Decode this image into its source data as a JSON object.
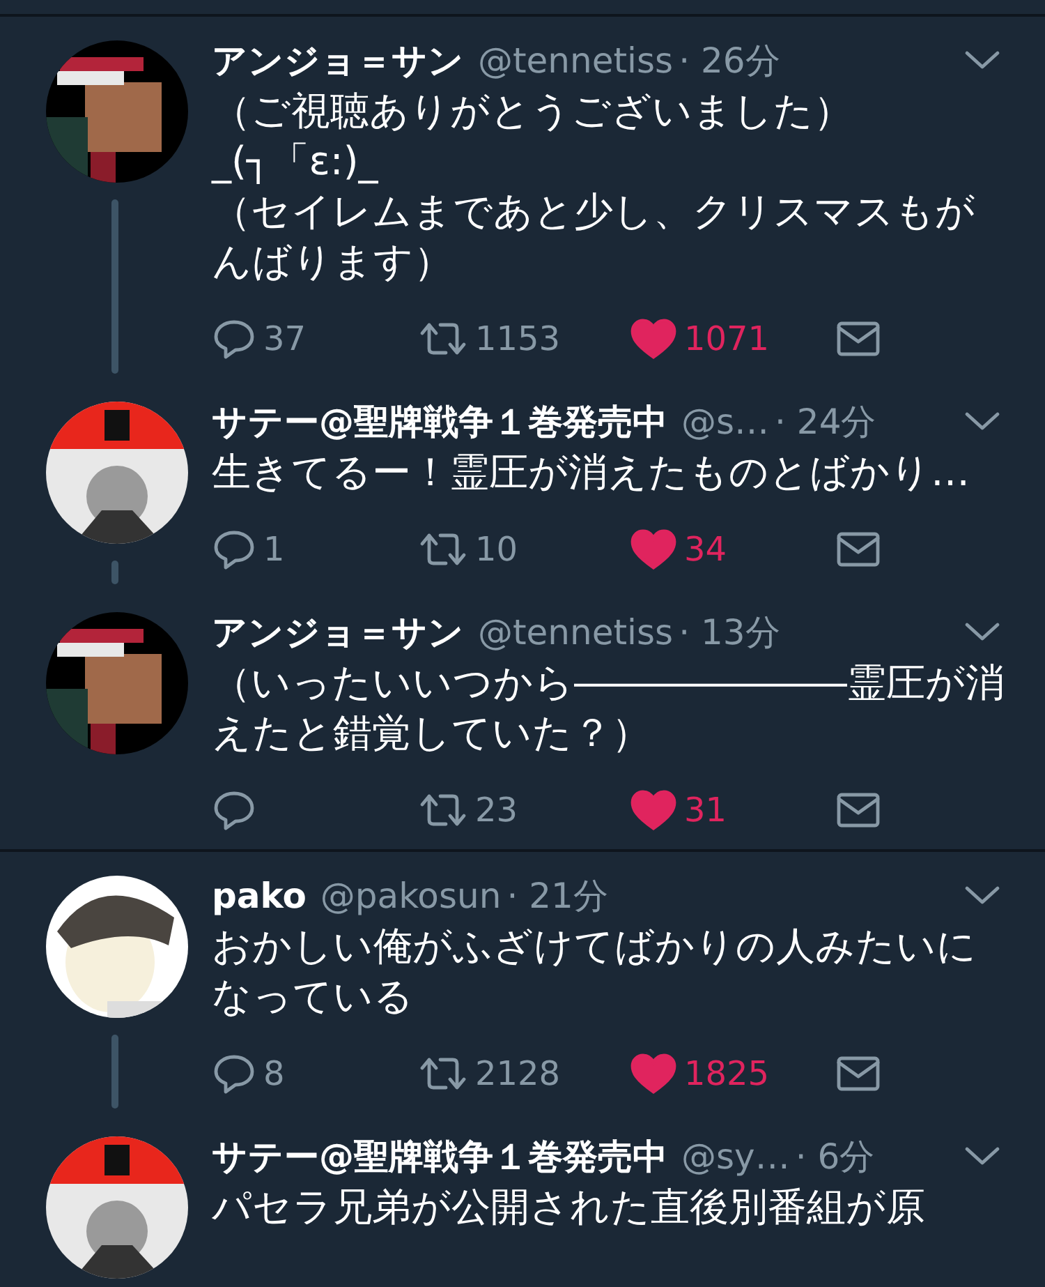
{
  "conversations": [
    {
      "tweets": [
        {
          "avatar": {
            "kind": "pixel"
          },
          "name": "アンジョ＝サン",
          "handle": "@tennetiss",
          "time": "· 26分",
          "body": "（ご視聴ありがとうございました）\n_(┐「ε:)_\n（セイレムまであと少し、クリスマスもがんばります）",
          "replies": "37",
          "retweets": "1153",
          "likes": "1071",
          "liked": true
        },
        {
          "avatar": {
            "kind": "red"
          },
          "name": "サテー@聖牌戦争１巻発売中",
          "handle": "@s…",
          "time": "· 24分",
          "body": "生きてるー！霊圧が消えたものとばかり…",
          "replies": "1",
          "retweets": "10",
          "likes": "34",
          "liked": true
        },
        {
          "avatar": {
            "kind": "pixel"
          },
          "name": "アンジョ＝サン",
          "handle": "@tennetiss",
          "time": "· 13分",
          "body": "（いったいいつから―――――――霊圧が消えたと錯覚していた？）",
          "retweets": "23",
          "likes": "31",
          "liked": true
        }
      ]
    },
    {
      "tweets": [
        {
          "avatar": {
            "kind": "sketch"
          },
          "name": "pako",
          "handle": "@pakosun",
          "time": "· 21分",
          "body": "おかしい俺がふざけてばかりの人みたいになっている",
          "replies": "8",
          "retweets": "2128",
          "likes": "1825",
          "liked": true
        },
        {
          "avatar": {
            "kind": "red"
          },
          "name": "サテー@聖牌戦争１巻発売中",
          "handle": "@sy…",
          "time": "· 6分",
          "body": "パセラ兄弟が公開された直後別番組が原"
        }
      ]
    }
  ]
}
